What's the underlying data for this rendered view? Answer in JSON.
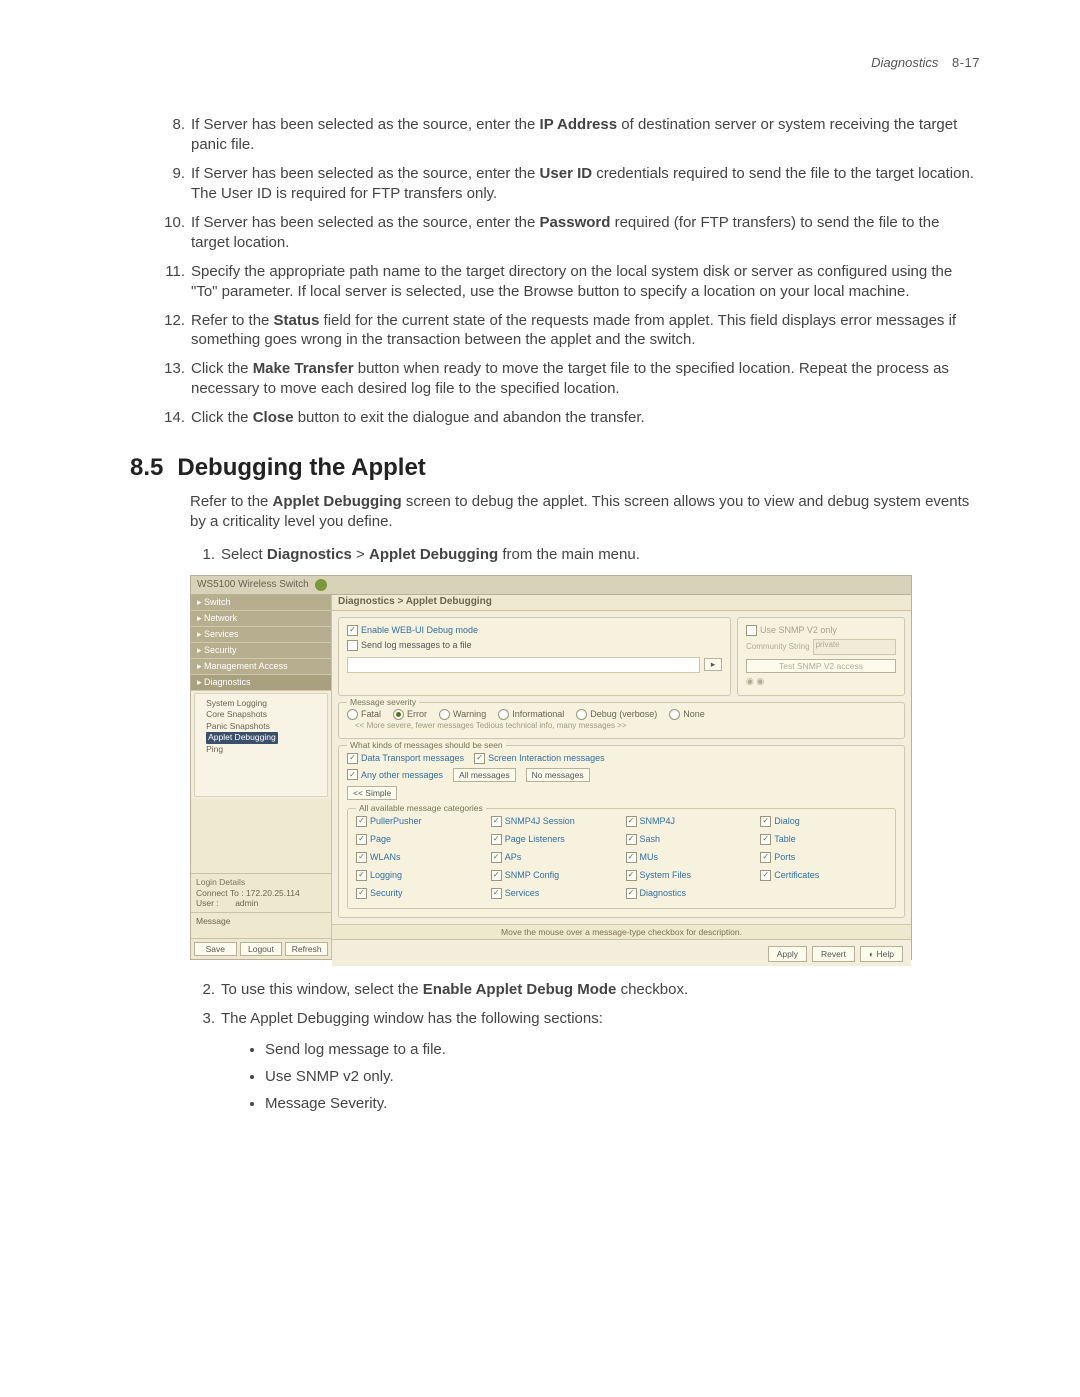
{
  "running_head": {
    "chapter": "Diagnostics",
    "page": "8-17"
  },
  "steps_top": [
    {
      "num": "8.",
      "pre": "If Server has been selected as the source, enter the ",
      "bold": "IP Address",
      "post": " of destination server or system receiving the target panic file."
    },
    {
      "num": "9.",
      "pre": "If Server has been selected as the source, enter the ",
      "bold": "User ID",
      "post": " credentials required to send the file to the target location. The User ID is required for FTP transfers only."
    },
    {
      "num": "10.",
      "pre": "If Server has been selected as the source, enter the ",
      "bold": "Password",
      "post": " required (for FTP transfers) to send the file to the target location."
    },
    {
      "num": "11.",
      "pre": "Specify the appropriate path name to the target directory on the local system disk or server as configured using the \"To\" parameter. If local server is selected, use the Browse button to specify a location on your local machine.",
      "bold": "",
      "post": ""
    },
    {
      "num": "12.",
      "pre": "Refer to the ",
      "bold": "Status",
      "post": " field for the current state of the requests made from applet. This field displays error messages if something goes wrong in the transaction between the applet and the switch."
    },
    {
      "num": "13.",
      "pre": "Click the ",
      "bold": "Make Transfer",
      "post": " button when ready to move the target file to the specified location. Repeat the process as necessary to move each desired log file to the specified location."
    },
    {
      "num": "14.",
      "pre": "Click the ",
      "bold": "Close",
      "post": " button to exit the dialogue and abandon the transfer."
    }
  ],
  "heading": {
    "num": "8.5",
    "title": "Debugging the Applet"
  },
  "intro": {
    "pre": "Refer to the ",
    "bold": "Applet Debugging",
    "post": " screen to debug the applet. This screen allows you to view and debug system events by a criticality level you define."
  },
  "step1": {
    "num": "1.",
    "pre": "Select ",
    "bold1": "Diagnostics",
    "gt": "  >  ",
    "bold2": "Applet Debugging",
    "post": " from the main menu."
  },
  "ui": {
    "title": "WS5100 Wireless Switch",
    "crumb": "Diagnostics > Applet Debugging",
    "nav": {
      "items": [
        "Switch",
        "Network",
        "Services",
        "Security",
        "Management Access",
        "Diagnostics"
      ],
      "tree": [
        "System Logging",
        "Core Snapshots",
        "Panic Snapshots",
        "Applet Debugging",
        "Ping"
      ],
      "tree_sel_index": 3
    },
    "login": {
      "header": "Login Details",
      "connect_lbl": "Connect To :",
      "connect_val": "172.20.25.114",
      "user_lbl": "User :",
      "user_val": "admin"
    },
    "msg_header": "Message",
    "bottom_btns": [
      "Save",
      "Logout",
      "Refresh"
    ],
    "left_box": {
      "enable": "Enable WEB-UI Debug mode",
      "sendlog": "Send log messages to a file"
    },
    "right_box": {
      "legend": "Use SNMP V2 only",
      "comm_lbl": "Community String",
      "comm_val": "private",
      "test_btn": "Test SNMP V2 access"
    },
    "sev": {
      "legend": "Message severity",
      "opts": [
        "Fatal",
        "Error",
        "Warning",
        "Informational",
        "Debug (verbose)",
        "None"
      ],
      "sel_index": 1,
      "hint": "<< More severe, fewer messages     Tedious technical info, many messages >>"
    },
    "seen": {
      "legend": "What kinds of messages should be seen",
      "c1": "Data Transport messages",
      "c2": "Screen Interaction messages",
      "c3": "Any other messages",
      "all_btn": "All messages",
      "none_btn": "No messages",
      "simple_btn": "<< Simple"
    },
    "cats": {
      "legend": "All available message categories",
      "items": [
        "PullerPusher",
        "SNMP4J Session",
        "SNMP4J",
        "Dialog",
        "Page",
        "Page Listeners",
        "Sash",
        "Table",
        "WLANs",
        "APs",
        "MUs",
        "Ports",
        "Logging",
        "SNMP Config",
        "System Files",
        "Certificates",
        "Security",
        "Services",
        "Diagnostics",
        ""
      ]
    },
    "desc_bar": "Move the mouse over a message-type checkbox for description.",
    "footer_btns": [
      "Apply",
      "Revert",
      "Help"
    ]
  },
  "step2": {
    "num": "2.",
    "pre": "To use this window, select the ",
    "bold": "Enable Applet Debug Mode",
    "post": " checkbox."
  },
  "step3": {
    "num": "3.",
    "text": "The Applet Debugging window has the following sections:"
  },
  "bullets": [
    "Send log message to a file.",
    "Use SNMP v2 only.",
    "Message Severity."
  ]
}
